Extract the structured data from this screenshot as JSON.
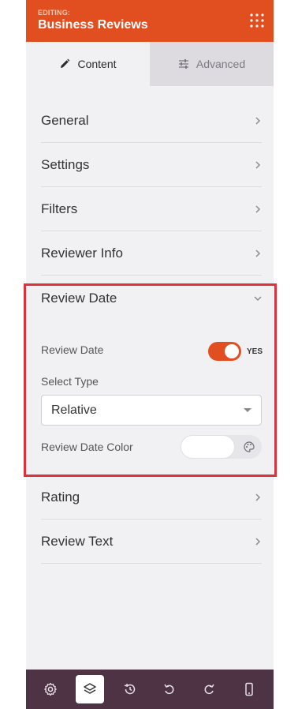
{
  "header": {
    "editing_label": "EDITING:",
    "title": "Business Reviews"
  },
  "tabs": [
    {
      "label": "Content",
      "icon": "pencil-icon",
      "active": true
    },
    {
      "label": "Advanced",
      "icon": "sliders-icon",
      "active": false
    }
  ],
  "sections": [
    {
      "label": "General"
    },
    {
      "label": "Settings"
    },
    {
      "label": "Filters"
    },
    {
      "label": "Reviewer Info"
    }
  ],
  "expanded_section": {
    "label": "Review Date",
    "fields": {
      "review_date_label": "Review Date",
      "review_date_toggle": "YES",
      "select_type_label": "Select Type",
      "select_type_value": "Relative",
      "color_label": "Review Date Color",
      "color_value": "#ffffff"
    }
  },
  "sections_after": [
    {
      "label": "Rating"
    },
    {
      "label": "Review Text"
    }
  ],
  "toolbar": [
    {
      "icon": "gear-icon"
    },
    {
      "icon": "layers-icon",
      "active": true
    },
    {
      "icon": "history-icon"
    },
    {
      "icon": "undo-icon"
    },
    {
      "icon": "redo-icon"
    },
    {
      "icon": "mobile-icon"
    }
  ],
  "colors": {
    "accent": "#e14f20",
    "toolbar_bg": "#4d3344",
    "highlight": "#e0303a"
  }
}
